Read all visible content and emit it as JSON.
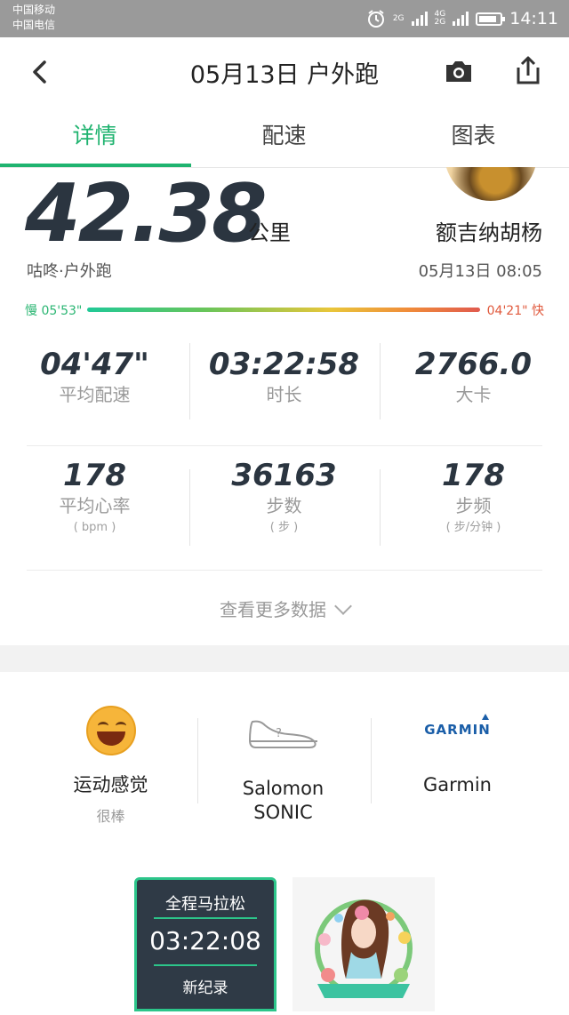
{
  "status_bar": {
    "carrier1": "中国移动",
    "carrier2": "中国电信",
    "net1": "2G",
    "net2a": "4G",
    "net2b": "2G",
    "time": "14:11",
    "battery_level": 0.85
  },
  "header": {
    "title": "05月13日 户外跑",
    "back_icon": "back-arrow-icon",
    "camera_icon": "camera-icon",
    "share_icon": "share-icon"
  },
  "tabs": [
    {
      "label": "详情",
      "active": true
    },
    {
      "label": "配速"
    },
    {
      "label": "图表"
    }
  ],
  "summary": {
    "distance": "42.38",
    "unit": "公里",
    "username": "额吉纳胡杨",
    "source": "咕咚·户外跑",
    "datetime": "05月13日 08:05",
    "pace_slow": "慢 05'53\"",
    "pace_fast": "04'21\" 快"
  },
  "stats": [
    {
      "value": "04'47\"",
      "label": "平均配速"
    },
    {
      "value": "03:22:58",
      "label": "时长"
    },
    {
      "value": "2766.0",
      "label": "大卡"
    },
    {
      "value": "178",
      "label": "平均心率",
      "unit": "( bpm )"
    },
    {
      "value": "36163",
      "label": "步数",
      "unit": "( 步 )"
    },
    {
      "value": "178",
      "label": "步频",
      "unit": "( 步/分钟 )"
    }
  ],
  "more_label": "查看更多数据",
  "equipment": [
    {
      "name": "运动感觉",
      "sub": "很棒"
    },
    {
      "name_line1": "Salomon",
      "name_line2": "SONIC"
    },
    {
      "brand_logo": "GARMIN",
      "name": "Garmin"
    }
  ],
  "badges": {
    "title": "全程马拉松",
    "time": "03:22:08",
    "record": "新纪录"
  },
  "colors": {
    "accent": "#1fb36f",
    "pace_slow": "#2bb673",
    "pace_fast": "#e0593c",
    "dark": "#2b3540"
  }
}
